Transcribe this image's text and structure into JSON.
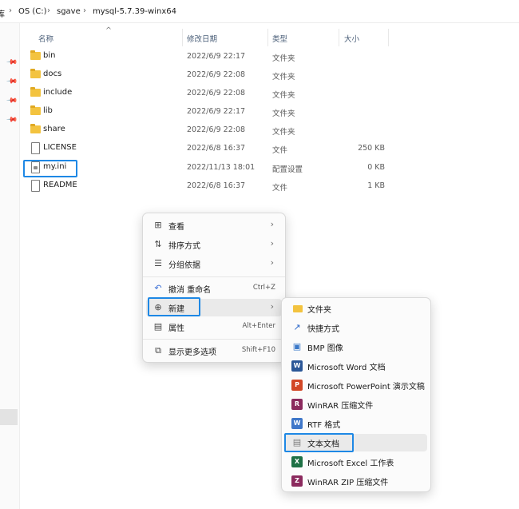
{
  "breadcrumb": {
    "partial_left": "库",
    "items": [
      "OS (C:)",
      "sgave",
      "mysql-5.7.39-winx64"
    ],
    "separator": "›"
  },
  "columns": {
    "name": "名称",
    "date": "修改日期",
    "type": "类型",
    "size": "大小",
    "sort_indicator": "^"
  },
  "files": [
    {
      "name": "bin",
      "date": "2022/6/9 22:17",
      "type": "文件夹",
      "size": "",
      "icon": "folder-icon"
    },
    {
      "name": "docs",
      "date": "2022/6/9 22:08",
      "type": "文件夹",
      "size": "",
      "icon": "folder-icon"
    },
    {
      "name": "include",
      "date": "2022/6/9 22:08",
      "type": "文件夹",
      "size": "",
      "icon": "folder-icon"
    },
    {
      "name": "lib",
      "date": "2022/6/9 22:17",
      "type": "文件夹",
      "size": "",
      "icon": "folder-icon"
    },
    {
      "name": "share",
      "date": "2022/6/9 22:08",
      "type": "文件夹",
      "size": "",
      "icon": "folder-icon"
    },
    {
      "name": "LICENSE",
      "date": "2022/6/8 16:37",
      "type": "文件",
      "size": "250 KB",
      "icon": "file-icon"
    },
    {
      "name": "my.ini",
      "date": "2022/11/13 18:01",
      "type": "配置设置",
      "size": "0 KB",
      "icon": "config-file-icon"
    },
    {
      "name": "README",
      "date": "2022/6/8 16:37",
      "type": "文件",
      "size": "1 KB",
      "icon": "file-icon"
    }
  ],
  "context_menu": {
    "view": {
      "label": "查看",
      "icon": "grid-view-icon"
    },
    "sort": {
      "label": "排序方式",
      "icon": "sort-icon"
    },
    "group": {
      "label": "分组依据",
      "icon": "group-icon"
    },
    "undo": {
      "label": "撤消 重命名",
      "shortcut": "Ctrl+Z",
      "icon": "undo-icon"
    },
    "new": {
      "label": "新建",
      "icon": "new-plus-icon"
    },
    "properties": {
      "label": "属性",
      "shortcut": "Alt+Enter",
      "icon": "properties-icon"
    },
    "more": {
      "label": "显示更多选项",
      "shortcut": "Shift+F10",
      "icon": "more-options-icon"
    }
  },
  "new_submenu": [
    {
      "label": "文件夹",
      "icon": "folder-icon"
    },
    {
      "label": "快捷方式",
      "icon": "shortcut-icon"
    },
    {
      "label": "BMP 图像",
      "icon": "bmp-icon"
    },
    {
      "label": "Microsoft Word 文档",
      "icon": "word-icon"
    },
    {
      "label": "Microsoft PowerPoint 演示文稿",
      "icon": "powerpoint-icon"
    },
    {
      "label": "WinRAR 压缩文件",
      "icon": "winrar-icon"
    },
    {
      "label": "RTF 格式",
      "icon": "rtf-icon"
    },
    {
      "label": "文本文档",
      "icon": "text-document-icon"
    },
    {
      "label": "Microsoft Excel 工作表",
      "icon": "excel-icon"
    },
    {
      "label": "WinRAR ZIP 压缩文件",
      "icon": "winrar-zip-icon"
    }
  ],
  "colors": {
    "highlight_box": "#1e88e5",
    "folder": "#f3c33f"
  }
}
